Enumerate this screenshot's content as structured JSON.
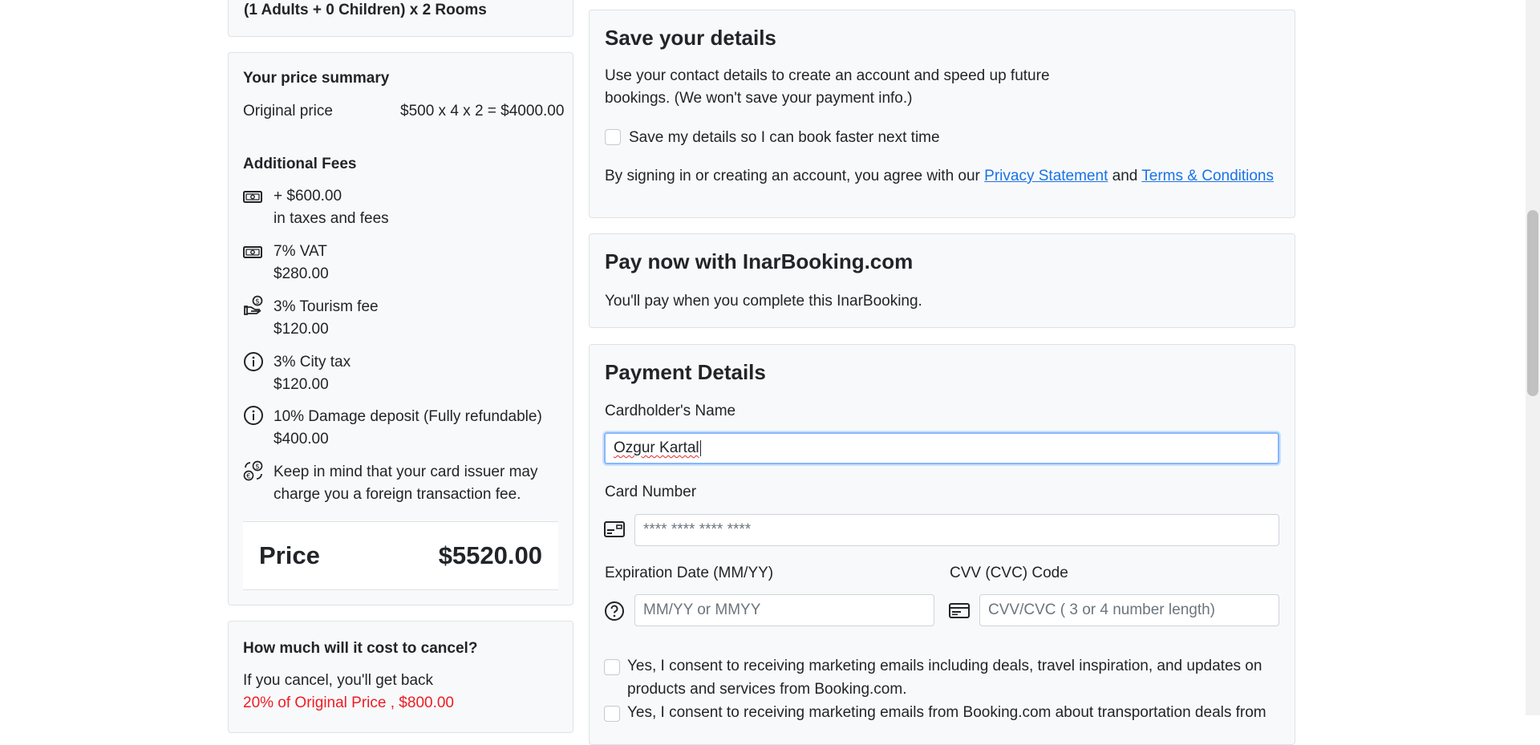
{
  "left": {
    "occupancy": "(1 Adults + 0 Children) x 2 Rooms",
    "price_summary": {
      "title": "Your price summary",
      "original_label": "Original price",
      "original_value": "$500 x 4 x 2 = $4000.00"
    },
    "fees": {
      "title": "Additional Fees",
      "items": [
        {
          "icon": "cash-icon",
          "line1": "+ $600.00",
          "line2": "in taxes and fees"
        },
        {
          "icon": "cash-icon",
          "line1": "7% VAT",
          "line2": "$280.00"
        },
        {
          "icon": "hand-coin-icon",
          "line1": "3% Tourism fee",
          "line2": "$120.00"
        },
        {
          "icon": "info-icon",
          "line1": "3% City tax",
          "line2": "$120.00"
        },
        {
          "icon": "info-icon",
          "line1": "10% Damage deposit (Fully refundable)",
          "line2": "$400.00"
        },
        {
          "icon": "currency-exchange-icon",
          "line1": "Keep in mind that your card issuer may",
          "line2": "charge you a foreign transaction fee."
        }
      ]
    },
    "total": {
      "label": "Price",
      "value": "$5520.00"
    },
    "cancel": {
      "title": "How much will it cost to cancel?",
      "text": "If you cancel, you'll get back",
      "refund": "20% of Original Price , $800.00"
    }
  },
  "save_details": {
    "title": "Save your details",
    "desc_line1": "Use your contact details to create an account and speed up future",
    "desc_line2": "bookings. (We won't save your payment info.)",
    "checkbox_label": "Save my details so I can book faster next time",
    "agree_prefix": "By signing in or creating an account, you agree with our",
    "privacy_link": "Privacy Statement",
    "and": "and",
    "terms_link": "Terms & Conditions"
  },
  "pay_now": {
    "title": "Pay now with InarBooking.com",
    "desc": "You'll pay when you complete this InarBooking."
  },
  "payment": {
    "title": "Payment Details",
    "cardholder_label": "Cardholder's Name",
    "cardholder_value": "Ozgur Kartal",
    "card_number_label": "Card Number",
    "card_number_placeholder": "**** **** **** ****",
    "expiry_label": "Expiration Date (MM/YY)",
    "expiry_placeholder": "MM/YY or MMYY",
    "cvv_label": "CVV (CVC) Code",
    "cvv_placeholder": "CVV/CVC ( 3 or 4 number length)",
    "consent1_line1": "Yes, I consent to receiving marketing emails including deals, travel inspiration, and updates on",
    "consent1_line2": "products and services from Booking.com.",
    "consent2_line1": "Yes, I consent to receiving marketing emails from Booking.com about transportation deals from"
  },
  "colors": {
    "accent_link": "#1a73e8",
    "refund_red": "#ee1c25",
    "focus_border": "#86b7fe"
  }
}
